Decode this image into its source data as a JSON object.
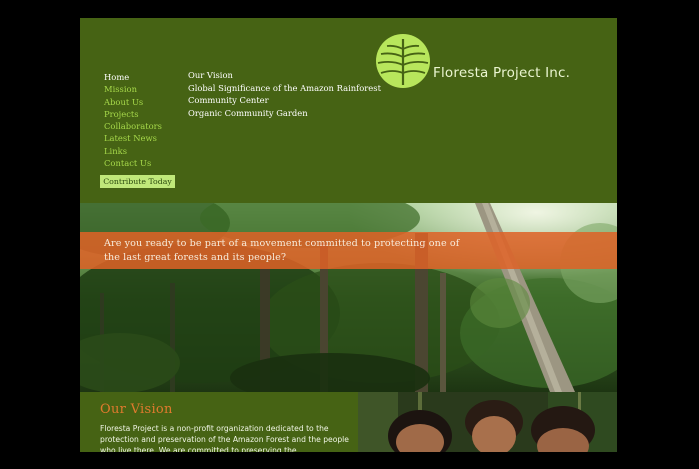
{
  "logo": {
    "name": "Floresta Project Inc.",
    "icon": "leaf-icon"
  },
  "nav": {
    "items": [
      {
        "label": "Home",
        "active": true
      },
      {
        "label": "Mission"
      },
      {
        "label": "About Us"
      },
      {
        "label": "Projects"
      },
      {
        "label": "Collaborators"
      },
      {
        "label": "Latest News"
      },
      {
        "label": "Links"
      },
      {
        "label": "Contact Us"
      }
    ],
    "contribute": "Contribute Today"
  },
  "subnav": {
    "items": [
      {
        "label": "Our Vision"
      },
      {
        "label": "Global Significance of the Amazon Rainforest"
      },
      {
        "label": "Community Center"
      },
      {
        "label": "Organic Community Garden"
      }
    ]
  },
  "hero": {
    "tagline": "Are you ready to be part of a movement committed to protecting one of the last great forests and its people?"
  },
  "vision": {
    "title": "Our Vision",
    "body": "Floresta Project is a non-profit organization dedicated to the protection and preservation of the Amazon Forest and the people who live there. We are committed to preserving the"
  },
  "colors": {
    "site_bg": "#466314",
    "nav_link": "#a6d84a",
    "accent_orange": "#de6226",
    "logo_green": "#b8e65c"
  }
}
